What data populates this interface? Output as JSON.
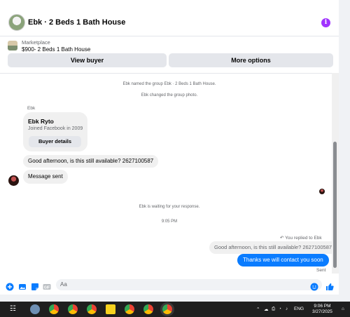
{
  "header": {
    "title": "Ebk · 2 Beds 1 Bath House",
    "info_glyph": "i"
  },
  "listing": {
    "source": "Marketplace",
    "summary": "$900- 2 Beds 1 Bath House",
    "view_buyer_label": "View buyer",
    "more_options_label": "More options"
  },
  "messages": {
    "system_1": "Ebk named the group Ebk · 2 Beds 1 Bath House.",
    "system_2": "Ebk changed the group photo.",
    "sender_label": "Ebk",
    "contact_card": {
      "name": "Ebk Ryto",
      "joined": "Joined Facebook in 2009",
      "button_label": "Buyer details"
    },
    "incoming_1": "Good afternoon, is this still available? 2627100587",
    "incoming_2": "Message sent",
    "system_waiting": "Ebk is waiting for your response.",
    "timestamp": "9:05 PM",
    "reply_label": "You replied to Ebk",
    "quoted_text": "Good afternoon, is this still available? 2627100587",
    "outgoing": "Thanks we will contact you soon",
    "status": "Sent"
  },
  "composer": {
    "placeholder": "Aa",
    "icons": [
      "plus-circle-icon",
      "photo-icon",
      "sticker-icon",
      "gif-icon",
      "emoji-icon",
      "thumbs-up-icon"
    ]
  },
  "taskbar": {
    "lang": "ENG",
    "time": "9:06 PM",
    "date": "3/27/2025"
  },
  "colors": {
    "accent": "#0a7cff",
    "info": "#a033ff",
    "bubble_in": "#f0f0f0",
    "taskbar": "#1f1f1f"
  }
}
